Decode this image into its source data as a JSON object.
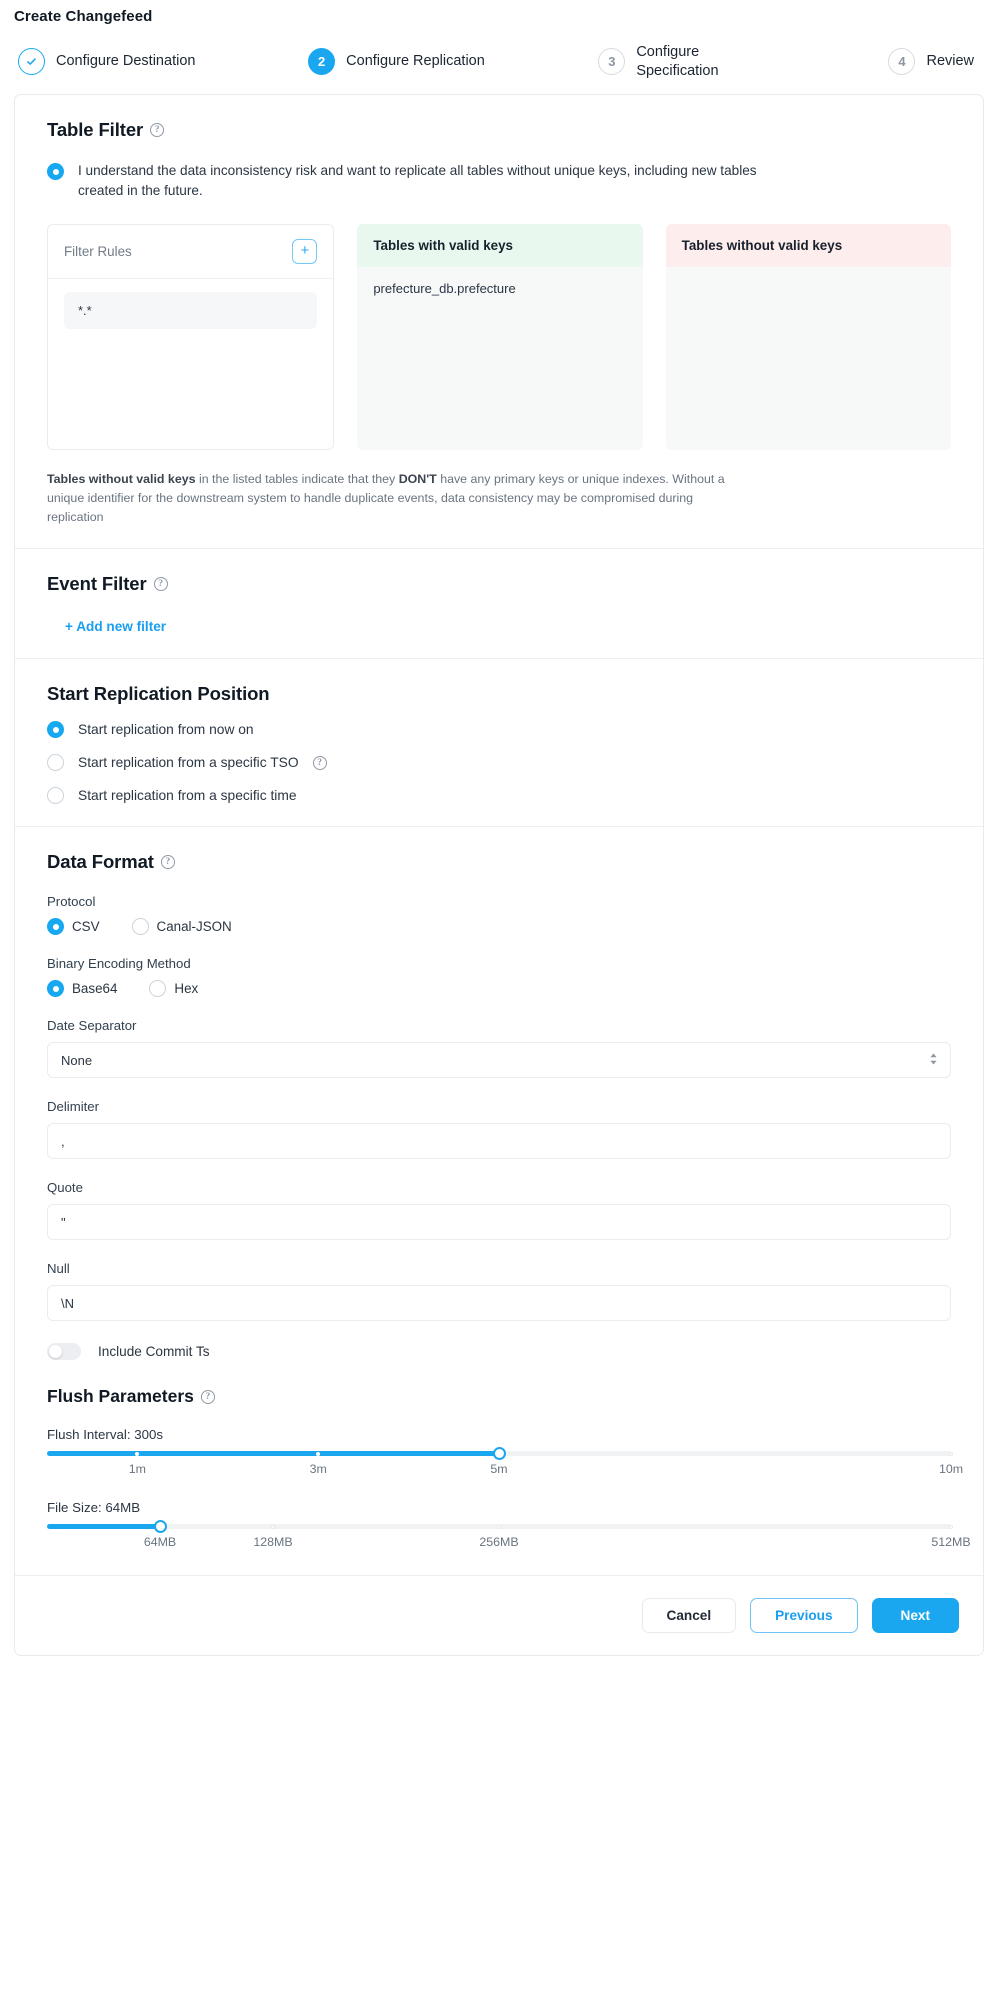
{
  "header": {
    "title": "Create Changefeed",
    "steps": [
      {
        "badge": "check",
        "state": "done",
        "label": "Configure Destination"
      },
      {
        "badge": "2",
        "state": "active",
        "label": "Configure Replication"
      },
      {
        "badge": "3",
        "state": "idle",
        "label": "Configure Specification"
      },
      {
        "badge": "4",
        "state": "idle",
        "label": "Review"
      }
    ]
  },
  "table_filter": {
    "title": "Table Filter",
    "risk_checkbox_text": "I understand the data inconsistency risk and want to replicate all tables without unique keys, including new tables created in the future.",
    "risk_checked": true,
    "filter_rules_label": "Filter Rules",
    "add_rule_icon": "plus-icon",
    "rules": [
      "*.*"
    ],
    "valid_panel_title": "Tables with valid keys",
    "valid_tables": [
      "prefecture_db.prefecture"
    ],
    "invalid_panel_title": "Tables without valid keys",
    "invalid_tables": [],
    "note_lead": "Tables without valid keys",
    "note_mid": " in the listed tables indicate that they ",
    "note_bold2": "DON'T",
    "note_tail": " have any primary keys or unique indexes. Without a unique identifier for the downstream system to handle duplicate events, data consistency may be compromised during replication"
  },
  "event_filter": {
    "title": "Event Filter",
    "add_link": "+ Add new filter"
  },
  "start_position": {
    "title": "Start Replication Position",
    "options": [
      {
        "label": "Start replication from now on",
        "selected": true,
        "help": false
      },
      {
        "label": "Start replication from a specific TSO",
        "selected": false,
        "help": true
      },
      {
        "label": "Start replication from a specific time",
        "selected": false,
        "help": false
      }
    ]
  },
  "data_format": {
    "title": "Data Format",
    "protocol_label": "Protocol",
    "protocol_options": [
      {
        "label": "CSV",
        "selected": true
      },
      {
        "label": "Canal-JSON",
        "selected": false
      }
    ],
    "binary_label": "Binary Encoding Method",
    "binary_options": [
      {
        "label": "Base64",
        "selected": true
      },
      {
        "label": "Hex",
        "selected": false
      }
    ],
    "date_separator_label": "Date Separator",
    "date_separator_value": "None",
    "delimiter_label": "Delimiter",
    "delimiter_value": ",",
    "quote_label": "Quote",
    "quote_value": "\"",
    "null_label": "Null",
    "null_value": "\\N",
    "include_commit_ts_label": "Include Commit Ts",
    "include_commit_ts_on": false
  },
  "flush": {
    "title": "Flush Parameters",
    "interval_label": "Flush Interval: 300s",
    "interval_percent": 50,
    "interval_ticks": [
      {
        "label": "1m",
        "percent": 10
      },
      {
        "label": "3m",
        "percent": 30
      },
      {
        "label": "5m",
        "percent": 50
      },
      {
        "label": "10m",
        "percent": 100
      }
    ],
    "filesize_label": "File Size: 64MB",
    "filesize_percent": 12.5,
    "filesize_ticks": [
      {
        "label": "64MB",
        "percent": 12.5
      },
      {
        "label": "128MB",
        "percent": 25
      },
      {
        "label": "256MB",
        "percent": 50
      },
      {
        "label": "512MB",
        "percent": 100
      }
    ]
  },
  "footer": {
    "cancel": "Cancel",
    "previous": "Previous",
    "next": "Next"
  },
  "colors": {
    "accent": "#1ba7f0",
    "valid_bg": "#e9f8ee",
    "invalid_bg": "#fdeded"
  }
}
